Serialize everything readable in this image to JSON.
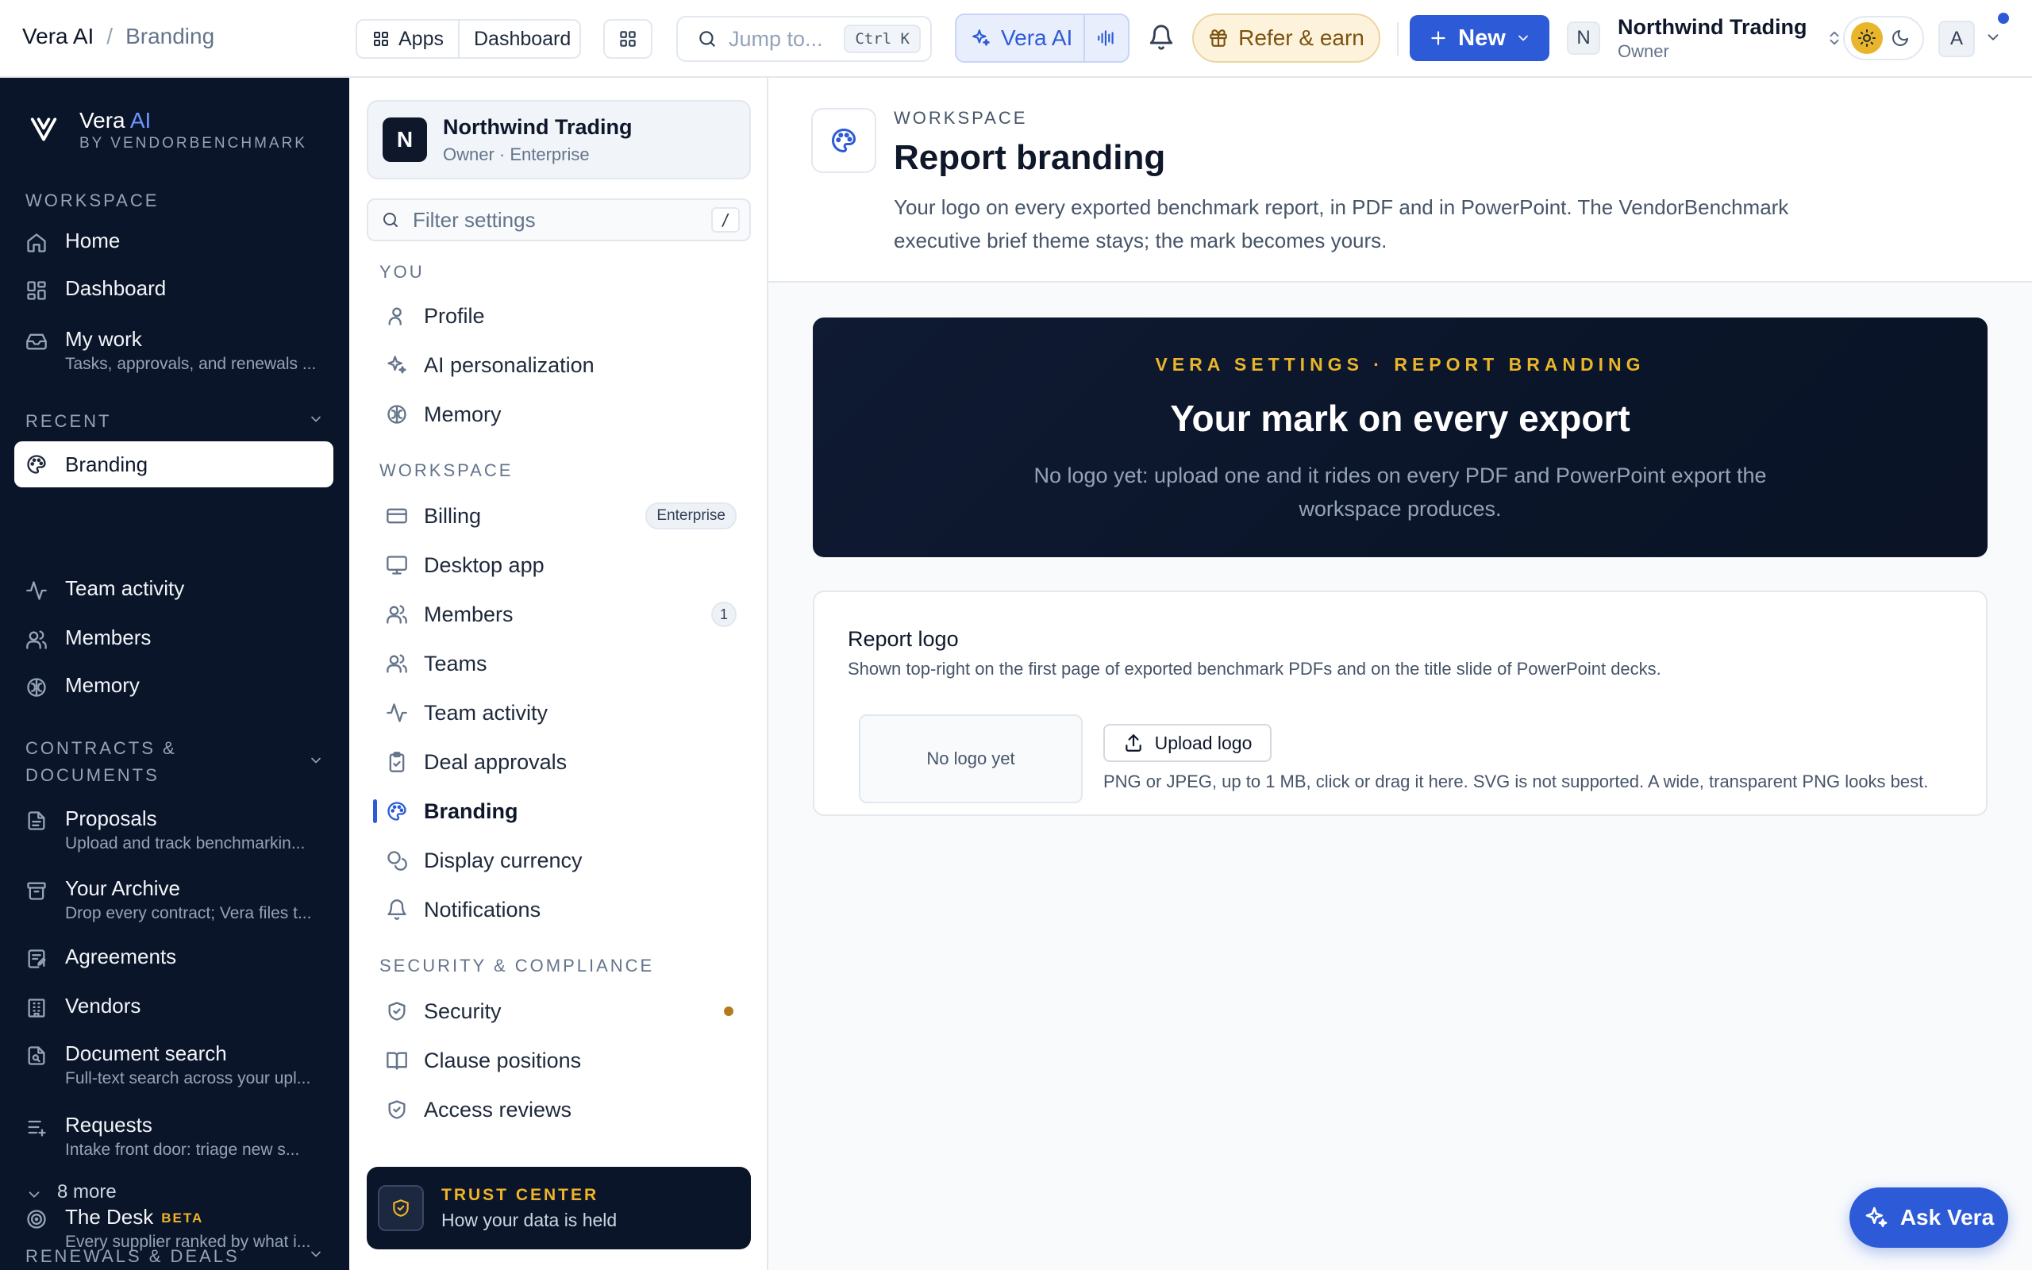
{
  "topbar": {
    "app_name": "Vera AI",
    "crumb_separator": "/",
    "page_name": "Branding",
    "apps_label": "Apps",
    "dashboard_label": "Dashboard",
    "search_placeholder": "Jump to...",
    "search_shortcut": "Ctrl K",
    "vera_label": "Vera AI",
    "refer_label": "Refer & earn",
    "new_label": "New",
    "org_initial": "N",
    "org_name": "Northwind Trading",
    "org_role": "Owner",
    "user_initial": "A",
    "icons": {
      "apps": "grid-icon",
      "launcher": "app-grid-icon",
      "search": "search-icon",
      "vera": "sparkles-icon",
      "voice": "waveform-icon",
      "bell": "bell-icon",
      "refer": "gift-icon",
      "new": "plus-icon",
      "theme_light": "sun-icon",
      "theme_dark": "moon-icon"
    }
  },
  "sidebar": {
    "brand_name": "Vera",
    "brand_ai": "AI",
    "brand_sub": "BY VENDORBENCHMARK",
    "workspace_header": "WORKSPACE",
    "workspace_items": [
      {
        "label": "Home",
        "icon": "home-icon"
      },
      {
        "label": "Dashboard",
        "icon": "dashboard-icon"
      },
      {
        "label": "My work",
        "sub": "Tasks, approvals, and renewals ...",
        "icon": "inbox-icon"
      }
    ],
    "recent_header": "RECENT",
    "recent_items": [
      {
        "label": "Branding",
        "icon": "palette-icon",
        "active": true
      },
      {
        "label": "Team activity",
        "icon": "activity-icon"
      },
      {
        "label": "Members",
        "icon": "users-icon"
      },
      {
        "label": "Memory",
        "icon": "brain-icon"
      }
    ],
    "contracts_header_line1": "CONTRACTS &",
    "contracts_header_line2": "DOCUMENTS",
    "contracts_items": [
      {
        "label": "Proposals",
        "sub": "Upload and track benchmarkin...",
        "icon": "file-text-icon"
      },
      {
        "label": "Your Archive",
        "sub": "Drop every contract; Vera files t...",
        "icon": "archive-icon"
      },
      {
        "label": "Agreements",
        "icon": "file-signature-icon"
      },
      {
        "label": "Vendors",
        "icon": "building-icon"
      },
      {
        "label": "Document search",
        "sub": "Full-text search across your upl...",
        "icon": "file-search-icon"
      },
      {
        "label": "Requests",
        "sub": "Intake front door: triage new s...",
        "icon": "list-plus-icon"
      }
    ],
    "more_label": "8 more",
    "renewals_header": "RENEWALS & DEALS",
    "desk_label": "The Desk",
    "desk_badge": "BETA",
    "desk_sub": "Every supplier ranked by what i..."
  },
  "settings_nav": {
    "org_initial": "N",
    "org_name": "Northwind Trading",
    "org_plan": "Owner · Enterprise",
    "filter_placeholder": "Filter settings",
    "filter_shortcut": "/",
    "you_header": "YOU",
    "you_items": [
      {
        "label": "Profile",
        "icon": "user-icon"
      },
      {
        "label": "AI personalization",
        "icon": "sparkles-icon"
      },
      {
        "label": "Memory",
        "icon": "brain-icon"
      }
    ],
    "workspace_header": "WORKSPACE",
    "workspace_items": [
      {
        "label": "Billing",
        "icon": "credit-card-icon",
        "badge": "Enterprise"
      },
      {
        "label": "Desktop app",
        "icon": "monitor-icon"
      },
      {
        "label": "Members",
        "icon": "users-icon",
        "count": "1"
      },
      {
        "label": "Teams",
        "icon": "users-icon"
      },
      {
        "label": "Team activity",
        "icon": "activity-icon"
      },
      {
        "label": "Deal approvals",
        "icon": "clipboard-check-icon"
      },
      {
        "label": "Branding",
        "icon": "palette-icon",
        "active": true
      },
      {
        "label": "Display currency",
        "icon": "coins-icon"
      },
      {
        "label": "Notifications",
        "icon": "bell-icon"
      }
    ],
    "security_header": "SECURITY & COMPLIANCE",
    "security_items": [
      {
        "label": "Security",
        "icon": "shield-check-icon",
        "dot": true
      },
      {
        "label": "Clause positions",
        "icon": "book-open-icon"
      },
      {
        "label": "Access reviews",
        "icon": "shield-check-icon"
      }
    ],
    "trust_title": "TRUST CENTER",
    "trust_sub": "How your data is held"
  },
  "main": {
    "eyebrow": "WORKSPACE",
    "title": "Report branding",
    "description": "Your logo on every exported benchmark report, in PDF and in PowerPoint. The VendorBenchmark executive brief theme stays; the mark becomes yours.",
    "hero_eyebrow": "VERA SETTINGS · REPORT BRANDING",
    "hero_title": "Your mark on every export",
    "hero_desc": "No logo yet: upload one and it rides on every PDF and PowerPoint export the workspace produces.",
    "card_title": "Report logo",
    "card_sub": "Shown top-right on the first page of exported benchmark PDFs and on the title slide of PowerPoint decks.",
    "logo_placeholder": "No logo yet",
    "upload_label": "Upload logo",
    "upload_hint": "PNG or JPEG, up to 1 MB, click or drag it here. SVG is not supported. A wide, transparent PNG looks best."
  },
  "ask_label": "Ask Vera",
  "colors": {
    "accent": "#2d5bd7",
    "sidebar_bg": "#0b1529",
    "gold": "#e9b52a"
  }
}
